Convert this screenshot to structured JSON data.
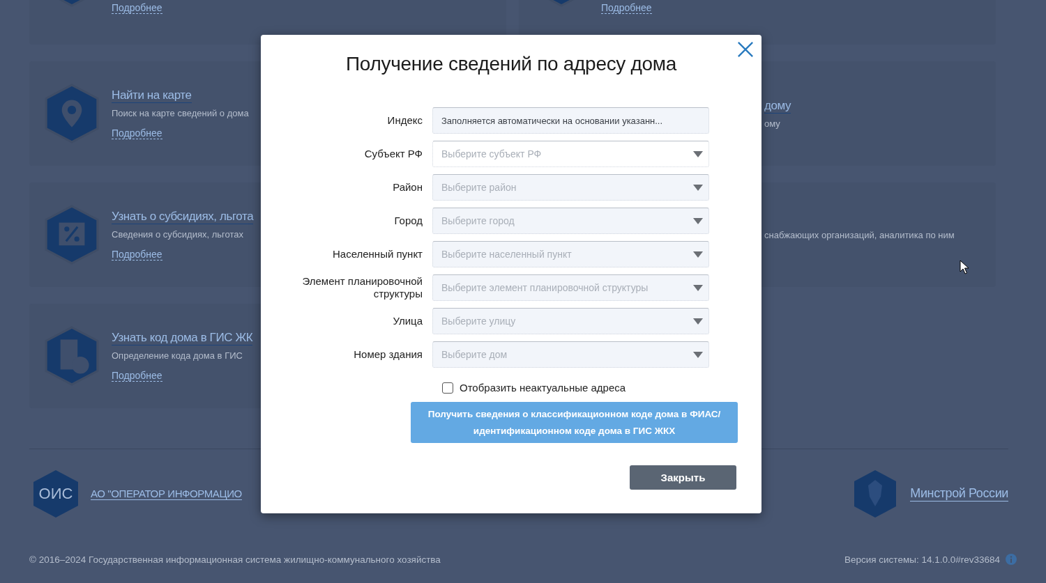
{
  "background_cards": {
    "left": [
      {
        "kind": "tools",
        "more": "Подробнее"
      },
      {
        "kind": "map",
        "title": "Найти на карте",
        "description": "Поиск на карте сведений о дома",
        "more": "Подробнее"
      },
      {
        "kind": "discount",
        "title": "Узнать о субсидиях, льгота",
        "description": "Сведения о субсидиях, льготах",
        "more": "Подробнее"
      },
      {
        "kind": "building",
        "title": "Узнать код дома в ГИС ЖК",
        "description": "Определение кода дома в ГИС",
        "more": "Подробнее"
      }
    ],
    "right": [
      {
        "kind": "star",
        "more": "Подробнее"
      },
      {
        "kind": "none",
        "title": "дому",
        "description": "ому"
      },
      {
        "kind": "none",
        "description": "снабжающих организаций, аналитика по ним"
      }
    ]
  },
  "footer": {
    "partners": [
      {
        "kind": "ois",
        "logo_text": "ОИС",
        "link": "АО \"ОПЕРАТОР ИНФОРМАЦИО"
      },
      {
        "kind": "emblem",
        "link": "Минстрой России"
      }
    ],
    "copyright": "© 2016–2024 Государственная информационная система жилищно-коммунального хозяйства",
    "version": "Версия системы: 14.1.0.0#rev33684"
  },
  "dialog": {
    "title": "Получение сведений по адресу дома",
    "fields": [
      {
        "kind": "text",
        "label": "Индекс",
        "value": "Заполняется автоматически на основании указанн...",
        "disabled": true
      },
      {
        "kind": "select",
        "label": "Субъект РФ",
        "placeholder": "Выберите субъект РФ",
        "disabled": false
      },
      {
        "kind": "select",
        "label": "Район",
        "placeholder": "Выберите район",
        "disabled": true
      },
      {
        "kind": "select",
        "label": "Город",
        "placeholder": "Выберите город",
        "disabled": true
      },
      {
        "kind": "select",
        "label": "Населенный пункт",
        "placeholder": "Выберите населенный пункт",
        "disabled": true
      },
      {
        "kind": "select",
        "label": "Элемент планировочной структуры",
        "placeholder": "Выберите элемент планировочной структуры",
        "disabled": true
      },
      {
        "kind": "select",
        "label": "Улица",
        "placeholder": "Выберите улицу",
        "disabled": true
      },
      {
        "kind": "select",
        "label": "Номер здания",
        "placeholder": "Выберите дом",
        "disabled": true
      }
    ],
    "checkbox": {
      "label": "Отобразить неактуальные адреса",
      "checked": false
    },
    "submit_button": "Получить сведения о классификационном коде дома в ФИАС/ идентификационном коде дома в ГИС ЖКХ",
    "close_button": "Закрыть"
  }
}
